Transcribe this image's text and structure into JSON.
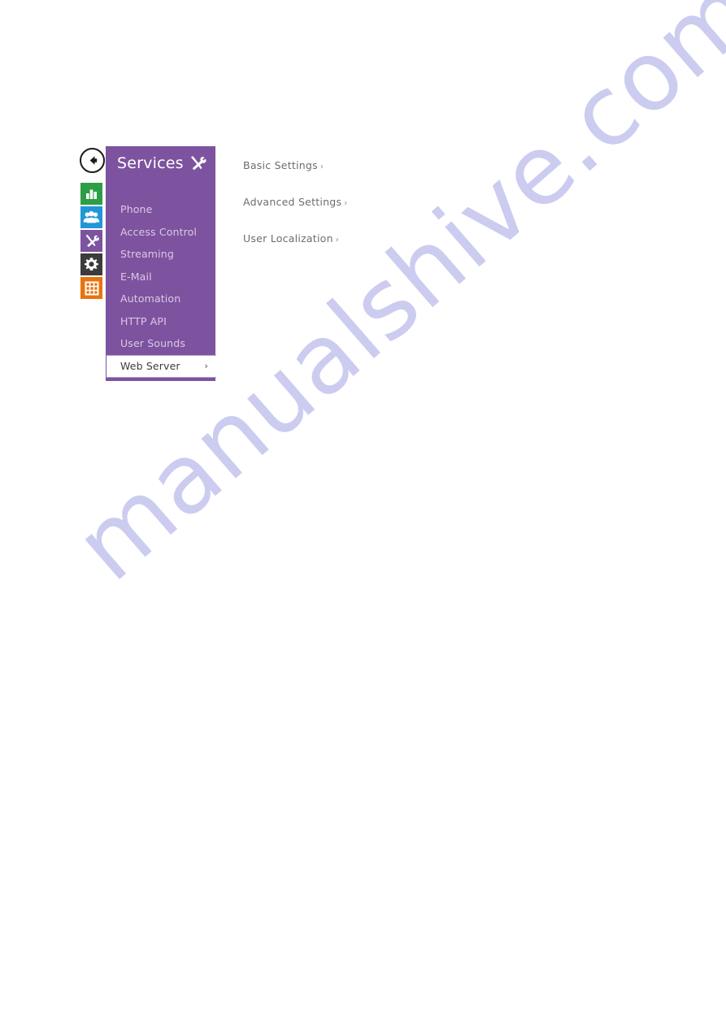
{
  "watermark": {
    "text": "manualshive.com",
    "color": "#ccccf0"
  },
  "theme": {
    "panel_purple": "#7d539f",
    "panel_text": "#dcc9e8",
    "active_bg": "#ffffff",
    "active_text": "#3c3c3c",
    "link_text": "#6d6d6d"
  },
  "back_button": {
    "name": "back-arrow",
    "tooltip": "Back"
  },
  "icon_rail": {
    "items": [
      {
        "name": "status-bar-chart-icon",
        "color": "#2e9e46"
      },
      {
        "name": "directory-people-icon",
        "color": "#2196d9"
      },
      {
        "name": "services-tools-icon",
        "color": "#7d539f"
      },
      {
        "name": "system-gear-icon",
        "color": "#3b3b3b"
      },
      {
        "name": "grid-apps-icon",
        "color": "#e8730d"
      }
    ]
  },
  "panel": {
    "title": "Services",
    "header_icon": "tools-icon",
    "items": [
      {
        "label": "Phone",
        "active": false
      },
      {
        "label": "Access Control",
        "active": false
      },
      {
        "label": "Streaming",
        "active": false
      },
      {
        "label": "E-Mail",
        "active": false
      },
      {
        "label": "Automation",
        "active": false
      },
      {
        "label": "HTTP API",
        "active": false
      },
      {
        "label": "User Sounds",
        "active": false
      },
      {
        "label": "Web Server",
        "active": true,
        "chevron": "›"
      }
    ]
  },
  "links": [
    {
      "label": "Basic Settings",
      "chevron": "›"
    },
    {
      "label": "Advanced Settings",
      "chevron": "›"
    },
    {
      "label": "User Localization",
      "chevron": "›"
    }
  ]
}
